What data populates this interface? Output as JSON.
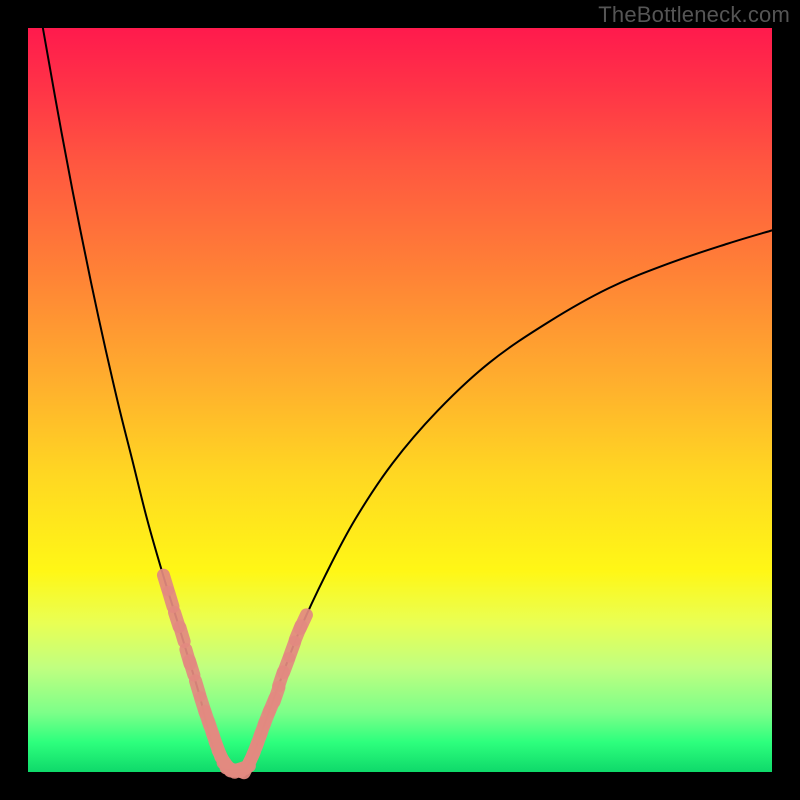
{
  "watermark": "TheBottleneck.com",
  "chart_data": {
    "type": "line",
    "title": "",
    "xlabel": "",
    "ylabel": "",
    "xlim": [
      0,
      100
    ],
    "ylim": [
      0,
      100
    ],
    "grid": false,
    "legend": false,
    "series": [
      {
        "name": "left-branch",
        "x": [
          2.0,
          4.5,
          7.0,
          9.5,
          12.0,
          14.0,
          16.0,
          18.0,
          20.0,
          21.5,
          23.0,
          24.0,
          25.0,
          25.7
        ],
        "values": [
          100,
          86.0,
          73.0,
          61.0,
          50.0,
          42.0,
          34.0,
          27.0,
          20.5,
          15.5,
          10.5,
          6.5,
          3.0,
          0.8
        ]
      },
      {
        "name": "valley-floor",
        "x": [
          25.7,
          26.6,
          27.6,
          28.6,
          29.5
        ],
        "values": [
          0.8,
          0.3,
          0.25,
          0.3,
          0.8
        ]
      },
      {
        "name": "right-branch",
        "x": [
          29.5,
          30.5,
          32.0,
          34.0,
          36.5,
          40.0,
          44.0,
          49.0,
          55.0,
          62.0,
          70.0,
          78.0,
          86.0,
          94.0,
          100.0
        ],
        "values": [
          0.8,
          3.0,
          7.0,
          12.5,
          19.0,
          26.5,
          34.0,
          41.5,
          48.5,
          55.0,
          60.5,
          65.0,
          68.3,
          71.0,
          72.8
        ]
      },
      {
        "name": "dotted-overlay-left",
        "style": "dots",
        "x": [
          18.5,
          19.2,
          20.0,
          20.7,
          21.5,
          22.0,
          22.8,
          23.5,
          24.1,
          24.6,
          25.1,
          25.5,
          26.0,
          26.5,
          27.0,
          27.6,
          28.2,
          28.8
        ],
        "values": [
          25.5,
          23.2,
          20.5,
          18.5,
          15.5,
          14.0,
          11.3,
          9.0,
          7.2,
          5.8,
          4.3,
          3.2,
          2.0,
          1.2,
          0.6,
          0.3,
          0.3,
          0.5
        ]
      },
      {
        "name": "dotted-overlay-right",
        "style": "dots",
        "x": [
          29.5,
          30.0,
          30.5,
          31.0,
          31.5,
          32.1,
          32.8,
          33.4,
          34.0,
          34.7,
          35.5,
          36.3,
          37.0
        ],
        "values": [
          0.8,
          1.8,
          3.0,
          4.3,
          5.7,
          7.3,
          9.0,
          10.4,
          12.5,
          14.3,
          16.5,
          18.7,
          20.2
        ]
      }
    ]
  }
}
